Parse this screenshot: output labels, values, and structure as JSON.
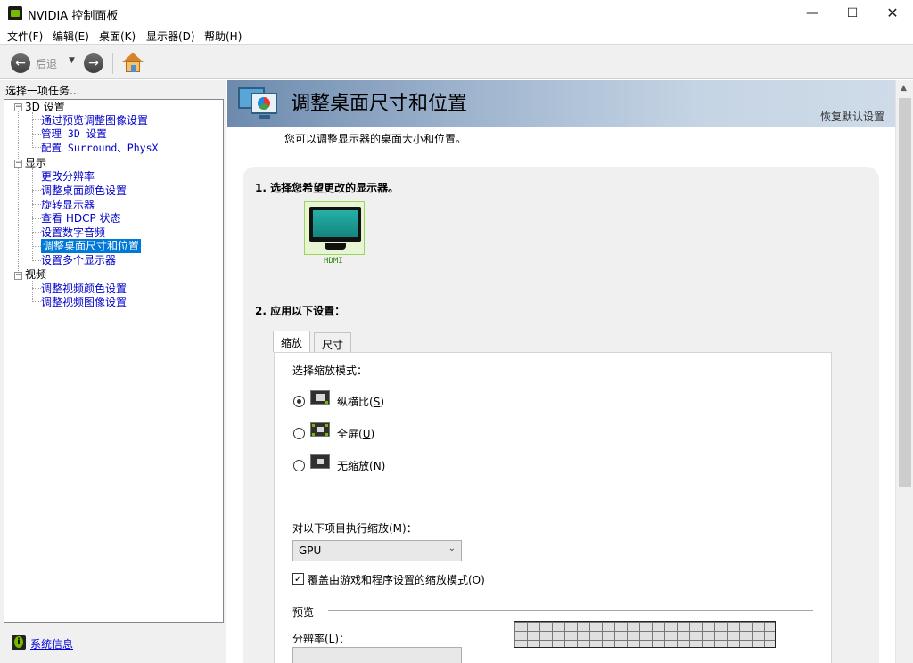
{
  "window": {
    "title": "NVIDIA 控制面板",
    "minimize_glyph": "—",
    "maximize_glyph": "☐",
    "close_glyph": "✕"
  },
  "menu": [
    "文件(F)",
    "编辑(E)",
    "桌面(K)",
    "显示器(D)",
    "帮助(H)"
  ],
  "toolbar": {
    "back_label": "后退",
    "back_glyph": "←",
    "forward_glyph": "→",
    "dropdown_glyph": "▼",
    "home_icon": "home-icon"
  },
  "sidebar": {
    "header": "选择一项任务...",
    "groups": [
      {
        "label": "3D 设置",
        "expander": "−",
        "items": [
          {
            "label": "通过预览调整图像设置"
          },
          {
            "label": "管理 3D 设置"
          },
          {
            "label": "配置 Surround、PhysX"
          }
        ]
      },
      {
        "label": "显示",
        "expander": "−",
        "items": [
          {
            "label": "更改分辨率"
          },
          {
            "label": "调整桌面颜色设置"
          },
          {
            "label": "旋转显示器"
          },
          {
            "label": "查看 HDCP 状态"
          },
          {
            "label": "设置数字音频"
          },
          {
            "label": "调整桌面尺寸和位置",
            "selected": true
          },
          {
            "label": "设置多个显示器"
          }
        ]
      },
      {
        "label": "视频",
        "expander": "−",
        "items": [
          {
            "label": "调整视频颜色设置"
          },
          {
            "label": "调整视频图像设置"
          }
        ]
      }
    ],
    "system_info": "系统信息"
  },
  "main": {
    "title": "调整桌面尺寸和位置",
    "restore_defaults": "恢复默认设置",
    "description": "您可以调整显示器的桌面大小和位置。",
    "section1": "1.  选择您希望更改的显示器。",
    "display_label": "HDMI",
    "section2": "2.  应用以下设置：",
    "tabs": [
      {
        "label": "缩放",
        "active": true
      },
      {
        "label": "尺寸",
        "active": false
      }
    ],
    "scaling_mode_label": "选择缩放模式：",
    "scaling_options": [
      {
        "label": "纵横比(",
        "key": "S",
        "suffix": ")",
        "checked": true,
        "icon": "aspect-ratio-icon"
      },
      {
        "label": "全屏(",
        "key": "U",
        "suffix": ")",
        "checked": false,
        "icon": "fullscreen-icon"
      },
      {
        "label": "无缩放(",
        "key": "N",
        "suffix": ")",
        "checked": false,
        "icon": "no-scaling-icon"
      }
    ],
    "perform_scaling_label": "对以下项目执行缩放(M)：",
    "perform_scaling_value": "GPU",
    "override_label": "覆盖由游戏和程序设置的缩放模式(O)",
    "override_checked": true,
    "preview_label": "预览",
    "resolution_label": "分辨率(L)："
  },
  "colors": {
    "nvidia_green": "#76b900",
    "selection_blue": "#0078d7",
    "link_blue": "#0000d8"
  }
}
